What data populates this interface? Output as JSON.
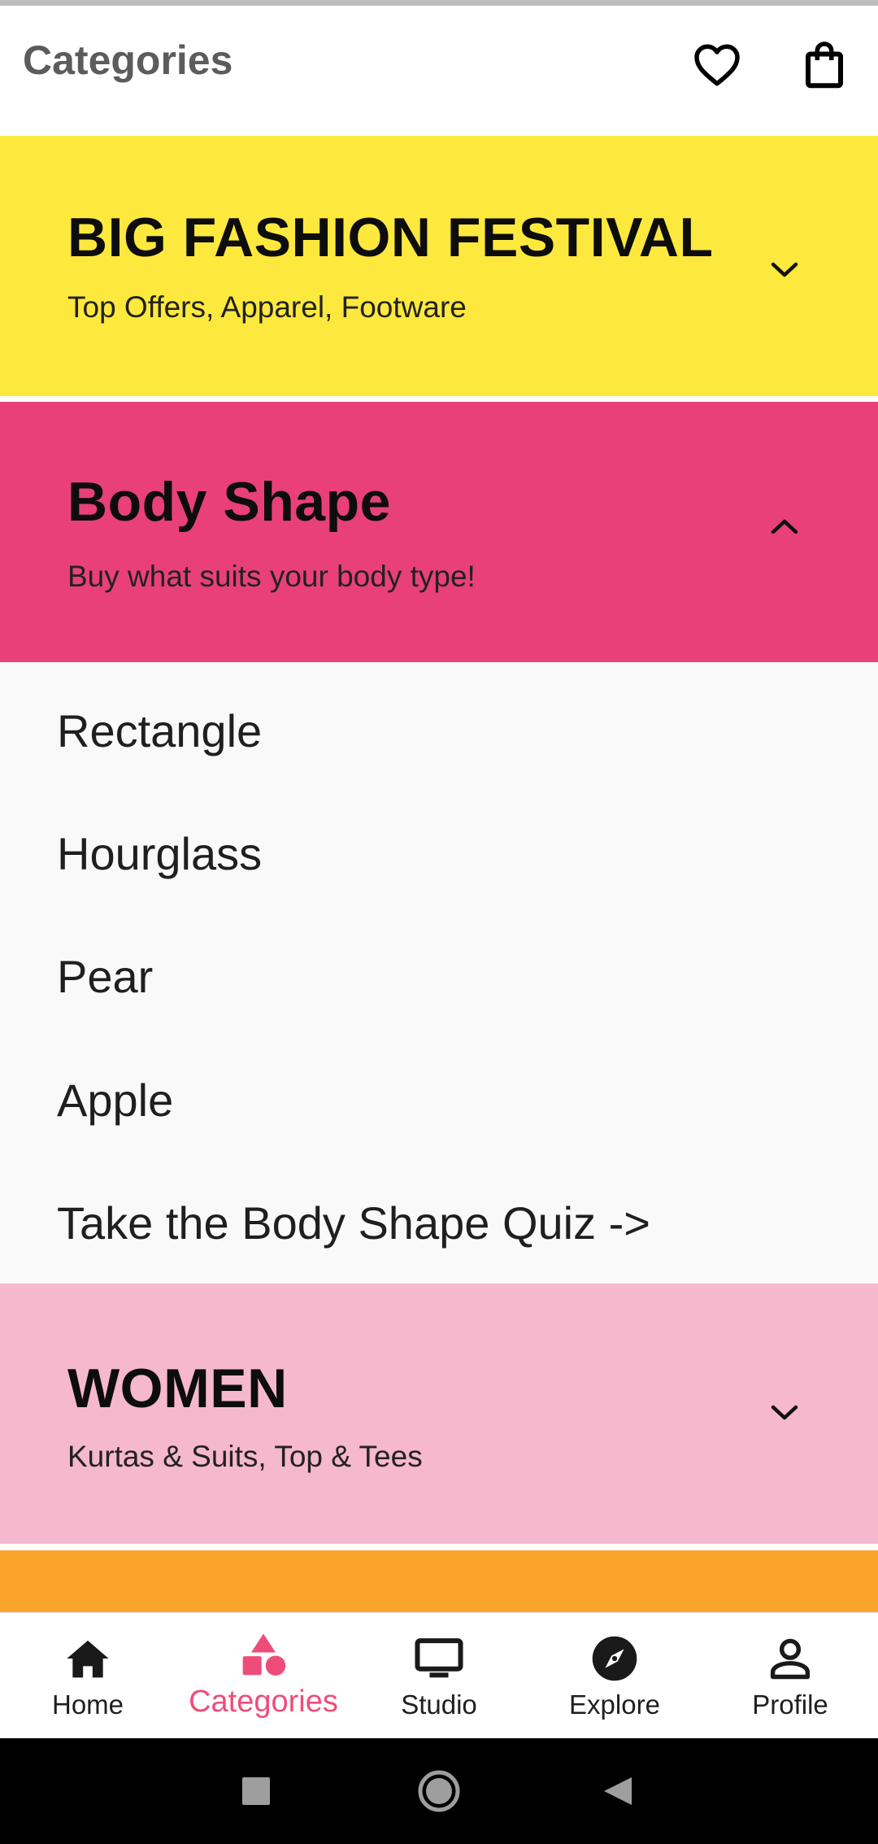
{
  "app": {
    "title": "Categories"
  },
  "header_icons": [
    "heart-icon",
    "shopping-bag-icon"
  ],
  "bands": [
    {
      "title": "BIG FASHION FESTIVAL",
      "subtitle": "Top Offers, Apparel, Footware",
      "color": "#fde93d",
      "expanded": false
    },
    {
      "title": "Body Shape",
      "subtitle": "Buy what suits your body type!",
      "color": "#e9407a",
      "expanded": true,
      "items": [
        "Rectangle",
        "Hourglass",
        "Pear",
        "Apple",
        "Take the Body Shape Quiz ->"
      ]
    },
    {
      "title": "WOMEN",
      "subtitle": "Kurtas & Suits, Top & Tees",
      "color": "#f6b8cd",
      "expanded": false
    },
    {
      "color": "#fba42b"
    }
  ],
  "bottom_nav": {
    "items": [
      {
        "label": "Home",
        "icon": "home-icon"
      },
      {
        "label": "Categories",
        "icon": "categories-shapes-icon",
        "active": true
      },
      {
        "label": "Studio",
        "icon": "tv-icon"
      },
      {
        "label": "Explore",
        "icon": "compass-icon"
      },
      {
        "label": "Profile",
        "icon": "person-icon"
      }
    ],
    "active_color": "#ee4d7a"
  },
  "system_nav": [
    "recents-square-icon",
    "home-circle-icon",
    "back-triangle-icon"
  ]
}
